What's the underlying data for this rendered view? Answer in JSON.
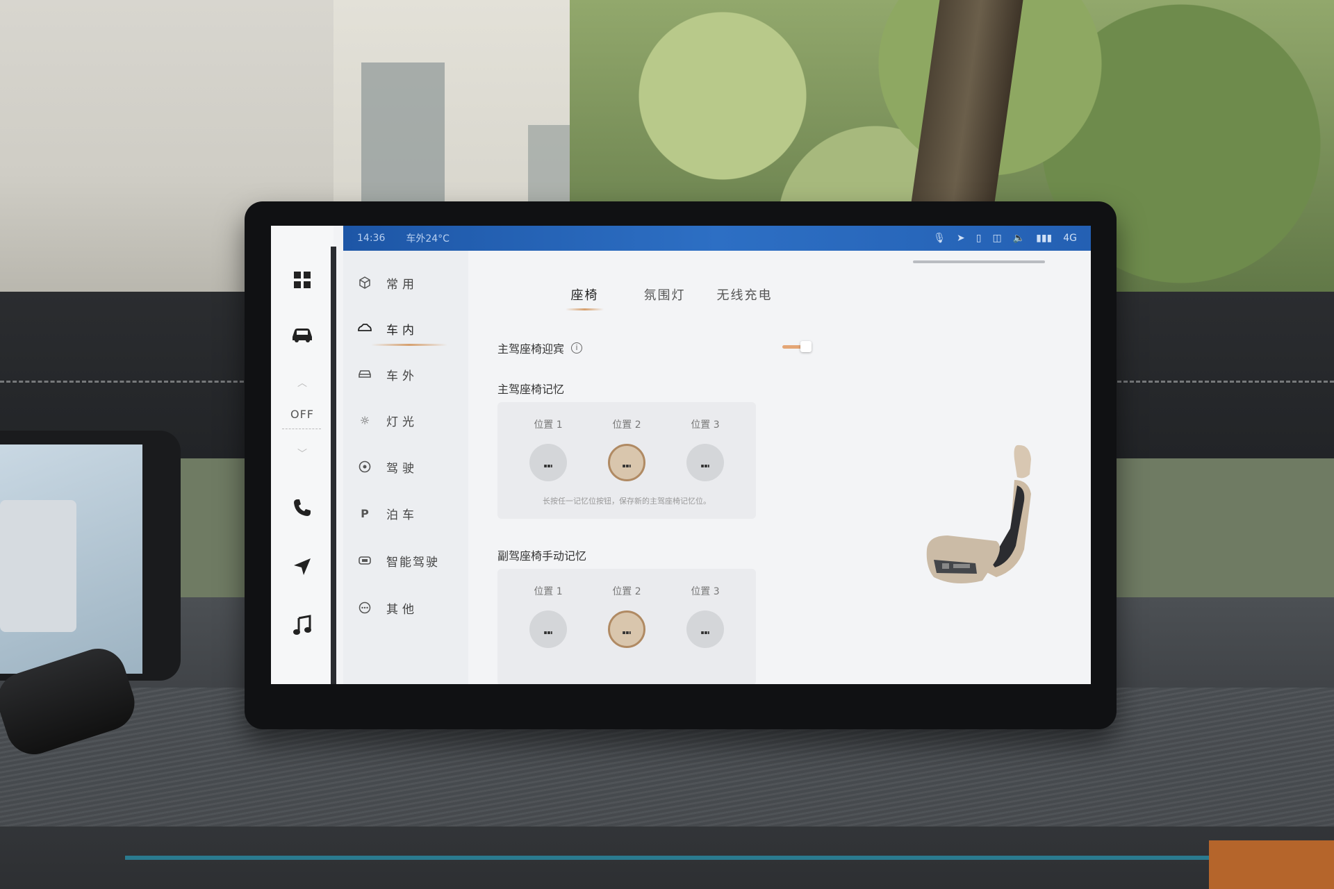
{
  "status_bar": {
    "time": "14:36",
    "outside_temp": "车外24°C",
    "network": "4G"
  },
  "rail": {
    "off_label": "OFF",
    "icons": [
      "apps-icon",
      "car-icon",
      "phone-icon",
      "navigation-icon",
      "music-icon"
    ]
  },
  "nav": {
    "items": [
      {
        "label": "常用",
        "icon": "cube-icon"
      },
      {
        "label": "车内",
        "icon": "car-interior-icon"
      },
      {
        "label": "车外",
        "icon": "car-exterior-icon"
      },
      {
        "label": "灯光",
        "icon": "light-icon"
      },
      {
        "label": "驾驶",
        "icon": "steering-icon"
      },
      {
        "label": "泊车",
        "icon": "parking-icon"
      },
      {
        "label": "智能驾驶",
        "icon": "smart-drive-icon"
      },
      {
        "label": "其他",
        "icon": "more-icon"
      }
    ],
    "active_index": 1
  },
  "tabs": [
    {
      "label": "座椅",
      "active": true
    },
    {
      "label": "氛围灯",
      "active": false
    },
    {
      "label": "无线充电",
      "active": false
    }
  ],
  "driver_welcome": {
    "label": "主驾座椅迎宾",
    "enabled": true
  },
  "driver_memory": {
    "title": "主驾座椅记忆",
    "slots": [
      {
        "label": "位置 1",
        "selected": false
      },
      {
        "label": "位置 2",
        "selected": true
      },
      {
        "label": "位置 3",
        "selected": false
      }
    ],
    "hint": "长按任一记忆位按钮，保存新的主驾座椅记忆位。"
  },
  "passenger_memory": {
    "title": "副驾座椅手动记忆",
    "slots": [
      {
        "label": "位置 1",
        "selected": false
      },
      {
        "label": "位置 2",
        "selected": true
      },
      {
        "label": "位置 3",
        "selected": false
      }
    ]
  },
  "colors": {
    "accent": "#d6a06e",
    "status_bar": "#2460b3",
    "selected_slot": "#d9c6ad"
  }
}
